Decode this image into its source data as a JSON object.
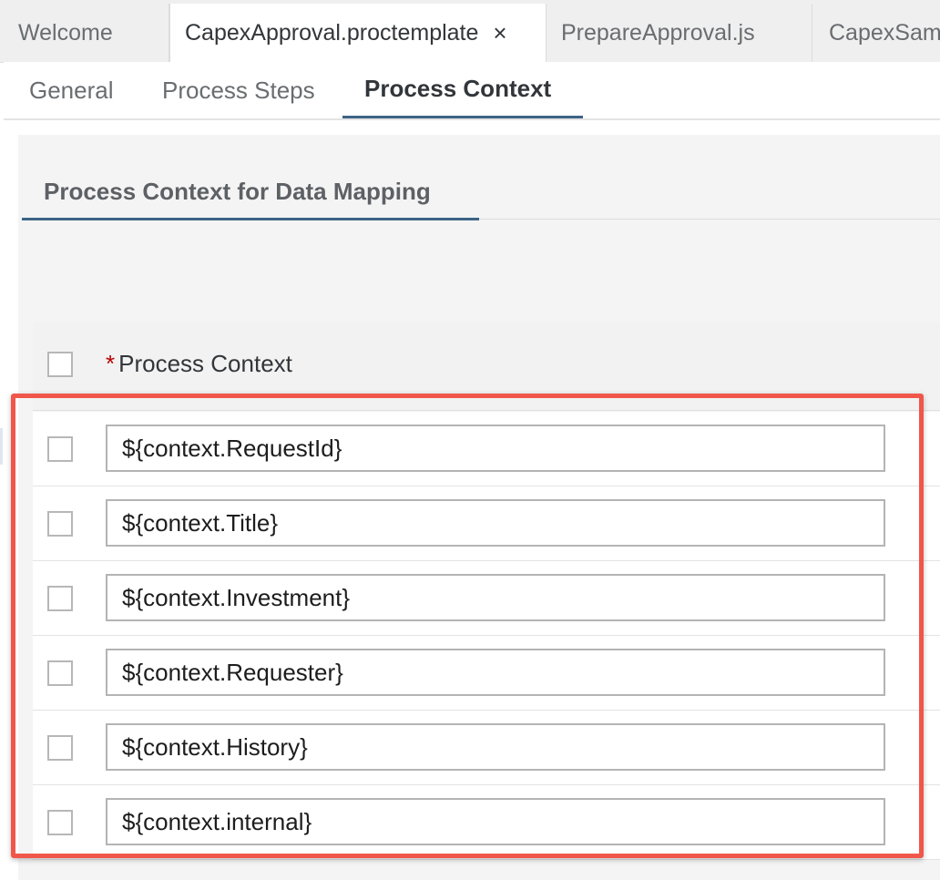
{
  "editor_tabs": [
    {
      "label": "Welcome"
    },
    {
      "label": "CapexApproval.proctemplate",
      "close_icon": "×",
      "active": true
    },
    {
      "label": "PrepareApproval.js"
    },
    {
      "label": "CapexSam"
    }
  ],
  "sub_tabs": [
    {
      "label": "General"
    },
    {
      "label": "Process Steps"
    },
    {
      "label": "Process Context",
      "active": true
    }
  ],
  "section": {
    "tab_label": "Process Context for Data Mapping"
  },
  "table": {
    "required_marker": "*",
    "column_header": "Process Context",
    "rows": [
      {
        "value": "${context.RequestId}"
      },
      {
        "value": "${context.Title}"
      },
      {
        "value": "${context.Investment}"
      },
      {
        "value": "${context.Requester}"
      },
      {
        "value": "${context.History}"
      },
      {
        "value": "${context.internal}"
      }
    ]
  },
  "colors": {
    "accent_underline": "#3c6485",
    "highlight_border": "#f0564a",
    "required": "#bb0000"
  }
}
